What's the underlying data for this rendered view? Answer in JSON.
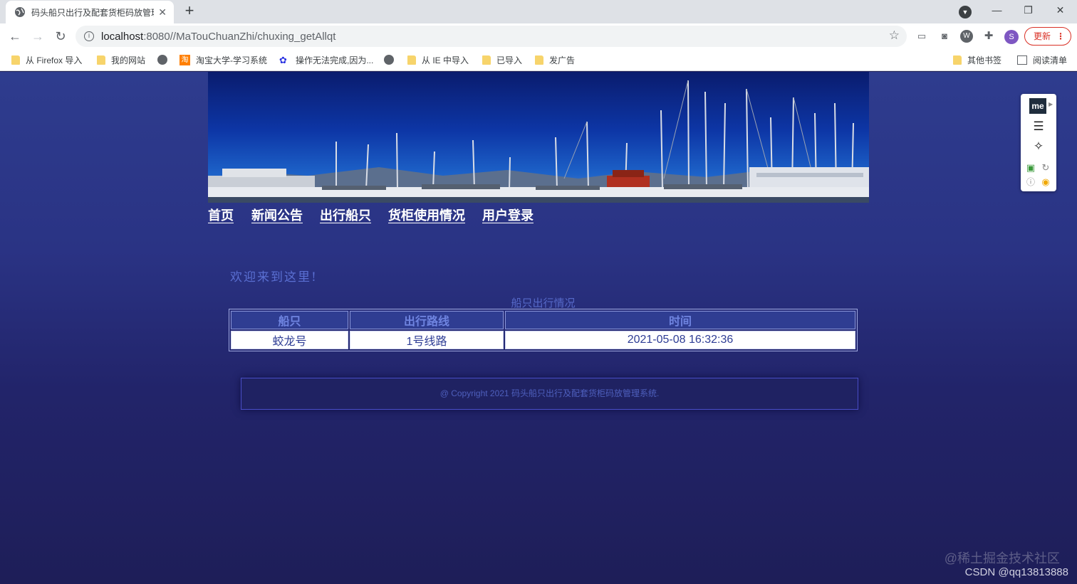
{
  "browser": {
    "tab_title": "码头船只出行及配套货柜码放管理系统",
    "tab_close": "✕",
    "new_tab": "+",
    "minimize": "—",
    "restore": "❐",
    "close": "✕",
    "url_host": "localhost",
    "url_rest": ":8080//MaTouChuanZhi/chuxing_getAllqt",
    "star": "☆",
    "avatar_letter": "S",
    "update_label": "更新",
    "menu_dots": "⋮",
    "bookmarks": [
      {
        "label": "从 Firefox 导入",
        "icon": "folder-icon"
      },
      {
        "label": "我的网站",
        "icon": "folder-icon"
      },
      {
        "label": "",
        "icon": "globe-icon"
      },
      {
        "label": "淘宝大学-学习系统",
        "icon": "taobao-icon"
      },
      {
        "label": "操作无法完成,因为...",
        "icon": "baidu-paw-icon"
      },
      {
        "label": "",
        "icon": "globe-icon"
      },
      {
        "label": "从 IE 中导入",
        "icon": "folder-icon"
      },
      {
        "label": "已导入",
        "icon": "folder-icon"
      },
      {
        "label": "发广告",
        "icon": "folder-icon"
      },
      {
        "label": "其他书签",
        "icon": "folder-icon"
      },
      {
        "label": "阅读清单",
        "icon": "reading-list-icon"
      }
    ]
  },
  "site": {
    "nav": [
      "首页",
      "新闻公告",
      "出行船只",
      "货柜使用情况",
      "用户登录"
    ],
    "welcome": "欢迎来到这里!",
    "table_caption": "船只出行情况",
    "table": {
      "headers": [
        "船只",
        "出行路线",
        "时间"
      ],
      "rows": [
        [
          "蛟龙号",
          "1号线路",
          "2021-05-08 16:32:36"
        ]
      ]
    },
    "footer": "@ Copyright 2021 码头船只出行及配套货柜码放管理系统."
  },
  "extension_panel": {
    "logo_text": "me"
  },
  "watermarks": {
    "line1": "@稀土掘金技术社区",
    "line2": "CSDN @qq13813888"
  }
}
